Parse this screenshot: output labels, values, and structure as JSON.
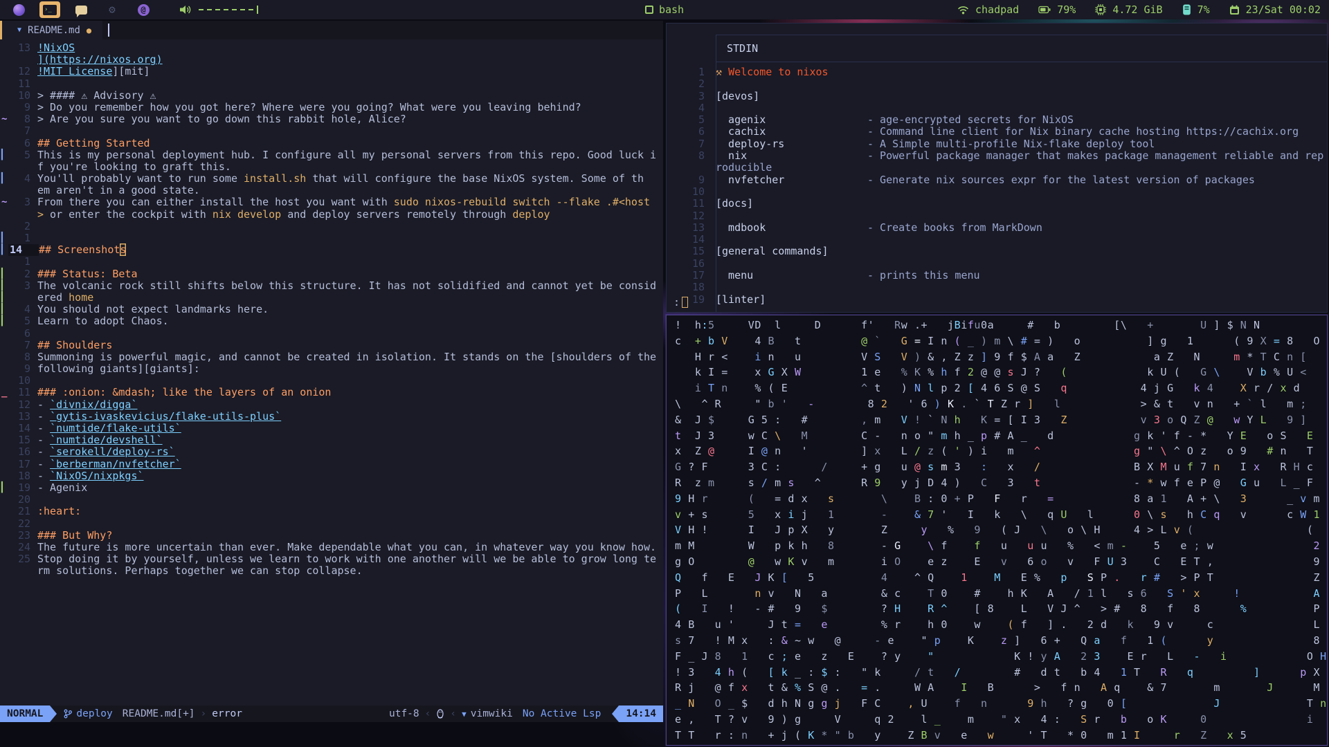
{
  "colors": {
    "fg": "#b5bdda",
    "bright": "#c8d0ea",
    "dim": "#565f89",
    "lnum": "#3b4261",
    "orange": "#ff9e64",
    "code": "#e0af68",
    "link": "#7dcfff",
    "blue": "#7aa2f7",
    "green": "#9ece6a",
    "magenta": "#bb9af7",
    "red": "#f7768e",
    "teal": "#73daca",
    "welcome": "#f4562b",
    "tool": "#d99a5e",
    "desc": "#9aa5ce"
  },
  "glyphs": {
    "gear": "⚙",
    "at": "@",
    "md_arrow": "▼",
    "modified_dot": "●",
    "term_glyph": "›_",
    "sep_r": "›",
    "sep_l": "‹",
    "vimwiki_arrow": "▼",
    "tool": "⚒",
    "prompt": ":"
  },
  "topbar": {
    "title": "bash",
    "user": "chadpad",
    "battery": "79%",
    "memory": "4.72 GiB",
    "cpu": "7%",
    "date": "23/Sat 00:02"
  },
  "editor": {
    "tab": {
      "title": "README.md"
    },
    "statusline": {
      "mode": "NORMAL",
      "branch": "deploy",
      "file": "README.md[+]",
      "diagnostic": "error",
      "encoding": "utf-8",
      "plugin": "vimwiki",
      "lsp": "No Active Lsp",
      "time": "14:14"
    },
    "lines": [
      {
        "n": "13",
        "t": [
          [
            "!NixOS",
            "link",
            "u"
          ]
        ]
      },
      {
        "n": "",
        "t": [
          [
            "](https://nixos.org)",
            "link",
            "u"
          ]
        ]
      },
      {
        "n": "12",
        "t": [
          [
            "!MIT License",
            "link",
            "u"
          ],
          [
            "][mit]",
            "fg"
          ]
        ]
      },
      {
        "n": "11"
      },
      {
        "n": "10",
        "t": [
          [
            "> #### ⚠ Advisory ⚠",
            "fg"
          ]
        ]
      },
      {
        "n": "9",
        "t": [
          [
            "> Do you remember how you got here? Where were you going? What were you leaving behind?",
            "fg"
          ]
        ]
      },
      {
        "n": "8",
        "s": "~",
        "t": [
          [
            "> Are you sure you want to go down this rabbit hole, Alice?",
            "fg"
          ]
        ]
      },
      {
        "n": "7"
      },
      {
        "n": "6",
        "t": [
          [
            "## Getting Started",
            "orange"
          ]
        ]
      },
      {
        "n": "5",
        "s": "b",
        "t": [
          [
            "This is my personal deployment hub. I configure all my personal servers from this repo. Good luck i",
            "fg"
          ]
        ]
      },
      {
        "n": "",
        "t": [
          [
            "f you're looking to graft this.",
            "fg"
          ]
        ]
      },
      {
        "n": "4",
        "s": "b",
        "t": [
          [
            "You'll probably want to run some ",
            "fg"
          ],
          [
            "install.sh",
            "code"
          ],
          [
            " that will configure the base NixOS system. Some of th",
            "fg"
          ]
        ]
      },
      {
        "n": "",
        "t": [
          [
            "em aren't in a good state.",
            "fg"
          ]
        ]
      },
      {
        "n": "3",
        "s": "~",
        "t": [
          [
            "From there you can either install the host you want with ",
            "fg"
          ],
          [
            "sudo nixos-rebuild switch --flake .#<host",
            "code"
          ]
        ]
      },
      {
        "n": "",
        "t": [
          [
            ">",
            "code"
          ],
          [
            " or enter the cockpit with ",
            "fg"
          ],
          [
            "nix develop",
            "code"
          ],
          [
            " and deploy servers remotely through ",
            "fg"
          ],
          [
            "deploy",
            "code"
          ]
        ]
      },
      {
        "n": "2"
      },
      {
        "n": "1",
        "s": "b"
      },
      {
        "n": "14",
        "cur": 1,
        "s": "b",
        "t": [
          [
            "## Screenshot",
            "orange"
          ],
          [
            "s",
            "orange",
            "k"
          ]
        ]
      },
      {
        "n": "1"
      },
      {
        "n": "2",
        "s": "g",
        "t": [
          [
            "### Status: Beta",
            "orange"
          ]
        ]
      },
      {
        "n": "3",
        "s": "g",
        "t": [
          [
            "The volcanic rock still shifts below this structure. It has not solidified and cannot yet be consid",
            "fg"
          ]
        ]
      },
      {
        "n": "",
        "s": "g",
        "t": [
          [
            "ered ",
            "fg"
          ],
          [
            "home",
            "code"
          ]
        ]
      },
      {
        "n": "4",
        "s": "g",
        "t": [
          [
            "You should not expect landmarks here.",
            "fg"
          ]
        ]
      },
      {
        "n": "5",
        "s": "g",
        "t": [
          [
            "Learn to adopt Chaos.",
            "fg"
          ]
        ]
      },
      {
        "n": "6"
      },
      {
        "n": "7",
        "t": [
          [
            "## Shoulders",
            "orange"
          ]
        ]
      },
      {
        "n": "8",
        "t": [
          [
            "Summoning is powerful magic, and cannot be created in isolation. It stands on the [shoulders of the",
            "fg"
          ]
        ]
      },
      {
        "n": "9",
        "t": [
          [
            "following giants][giants]:",
            "fg"
          ]
        ]
      },
      {
        "n": "10"
      },
      {
        "n": "11",
        "s": "_",
        "t": [
          [
            "### :onion: &mdash; like the layers of an onion",
            "orange"
          ]
        ]
      },
      {
        "n": "12",
        "t": [
          [
            "- ",
            "fg"
          ],
          [
            "`divnix/digga`",
            "link",
            "u"
          ]
        ]
      },
      {
        "n": "13",
        "t": [
          [
            "- ",
            "fg"
          ],
          [
            "`gytis-ivaskevicius/flake-utils-plus`",
            "link",
            "u"
          ]
        ]
      },
      {
        "n": "14",
        "t": [
          [
            "- ",
            "fg"
          ],
          [
            "`numtide/flake-utils`",
            "link",
            "u"
          ]
        ]
      },
      {
        "n": "15",
        "t": [
          [
            "- ",
            "fg"
          ],
          [
            "`numtide/devshell`",
            "link",
            "u"
          ]
        ]
      },
      {
        "n": "16",
        "t": [
          [
            "- ",
            "fg"
          ],
          [
            "`serokell/deploy-rs`",
            "link",
            "u"
          ]
        ]
      },
      {
        "n": "17",
        "t": [
          [
            "- ",
            "fg"
          ],
          [
            "`berberman/nvfetcher`",
            "link",
            "u"
          ]
        ]
      },
      {
        "n": "18",
        "t": [
          [
            "- ",
            "fg"
          ],
          [
            "`NixOS/nixpkgs`",
            "link",
            "u"
          ]
        ]
      },
      {
        "n": "19",
        "s": "g",
        "t": [
          [
            "- Agenix",
            "fg"
          ]
        ]
      },
      {
        "n": "20"
      },
      {
        "n": "21",
        "t": [
          [
            ":heart:",
            "orange"
          ]
        ]
      },
      {
        "n": "22"
      },
      {
        "n": "23",
        "t": [
          [
            "### But Why?",
            "orange"
          ]
        ]
      },
      {
        "n": "24",
        "t": [
          [
            "The future is more uncertain than ever. Make dependable what you can, in whatever way you know how.",
            "fg"
          ]
        ]
      },
      {
        "n": "25",
        "t": [
          [
            "Stop doing it by yourself, unless we learn to work with one another will we be able to grow long te",
            "fg"
          ]
        ]
      },
      {
        "n": "",
        "t": [
          [
            "rm solutions. Perhaps together we can stop collapse.",
            "fg"
          ]
        ]
      }
    ]
  },
  "stdin_win": {
    "title": "STDIN",
    "prompt": ":",
    "rows": [
      {
        "n": "1",
        "c": [
          [
            "⚒ ",
            "tool"
          ],
          [
            "Welcome to nixos",
            "welcome"
          ]
        ]
      },
      {
        "n": "2"
      },
      {
        "n": "3",
        "c": [
          [
            "[devos]",
            "bright"
          ]
        ]
      },
      {
        "n": "4"
      },
      {
        "n": "5",
        "c": [
          [
            "  agenix",
            "bright",
            219
          ],
          [
            "- age-encrypted secrets for NixOS",
            "desc"
          ]
        ]
      },
      {
        "n": "6",
        "c": [
          [
            "  cachix",
            "bright",
            219
          ],
          [
            "- Command line client for Nix binary cache hosting https://cachix.org",
            "desc"
          ]
        ]
      },
      {
        "n": "7",
        "c": [
          [
            "  deploy-rs",
            "bright",
            219
          ],
          [
            "- A Simple multi-profile Nix-flake deploy tool",
            "desc"
          ]
        ]
      },
      {
        "n": "8",
        "c": [
          [
            "  nix",
            "bright",
            219
          ],
          [
            "- Powerful package manager that makes package management reliable and rep",
            "desc"
          ]
        ]
      },
      {
        "n": "",
        "c": [
          [
            "roducible",
            "desc"
          ]
        ]
      },
      {
        "n": "9",
        "c": [
          [
            "  nvfetcher",
            "bright",
            219
          ],
          [
            "- Generate nix sources expr for the latest version of packages",
            "desc"
          ]
        ]
      },
      {
        "n": "10"
      },
      {
        "n": "11",
        "c": [
          [
            "[docs]",
            "bright"
          ]
        ]
      },
      {
        "n": "12"
      },
      {
        "n": "13",
        "c": [
          [
            "  mdbook",
            "bright",
            219
          ],
          [
            "- Create books from MarkDown",
            "desc"
          ]
        ]
      },
      {
        "n": "14"
      },
      {
        "n": "15",
        "c": [
          [
            "[general commands]",
            "bright"
          ]
        ]
      },
      {
        "n": "16"
      },
      {
        "n": "17",
        "c": [
          [
            "  menu",
            "bright",
            219
          ],
          [
            "- prints this menu",
            "desc"
          ]
        ]
      },
      {
        "n": "18"
      },
      {
        "n": "19",
        "c": [
          [
            "[linter]",
            "bright"
          ]
        ]
      }
    ]
  },
  "matrix": {
    "rows": [
      "!  h:5     VD  l     D      f'   Rw .+   jBifu0a     #   b        [\\   +       U ] $ N N",
      "c  + b V    4 B   t         @ `   G = I n ( _ ) m \\ # = )   o          ] g   1      ( 9 X = 8   O",
      "   H r <    i n   u         V S   V ) & , Z z ] 9 f $ A a   Z           a Z   N     m * T C n [   C",
      "   k I =    x G X W         1 e   % K % h f 2 @ @ s J ?   (            k U (   G \\    V b % U <    U",
      "   i T n    % ( E           ^ t   ) N l p 2 [ 4 6 S @ S   q           4 j G   k 4    X r / x d    d",
      "\\   ^ R     \" b '   -        8 2   ' 6 ) K . ` T Z r ]   l            > & t   v n   + ` l   m ;   N",
      "&  J $     G 5 :   #        , m   V ! ` N h   K = [ I 3   Z           v 3 o Q Z @   w Y L   9 ]   2",
      "t  J 3     w C \\   M        C -   n o \" m h _ p # A _   d            g k ' f - *   Y E   o S   E",
      "x  Z @     I @ n   '        ] x   L / z ( ' ) i   m   ^              g \" \\ ^ O z   o 9   # n   T",
      "G ? F      3 C :      /     + g   u @ s m 3   :   x   /              B X M u f 7 n   I x   R H c",
      "R  z m     s / m s   ^      R 9   y j D 4 )   C   3   t              - * w f e P @   G u   L _ F",
      "9 H r      (   = d x   s       \\    B : 0 + P   F   r   =            8 a 1   A + \\   3      _ v m",
      "v + s      5   x i j   1       -    & 7 '   I   k   \\   q U   l      0 \\ s   h C q   v      c W 1",
      "V H !      I   J p X   y       Z     y   %   9   ( J   \\   o \\ H     4 > L v (                 (",
      "m M        W   p k h   8       - G    \\ f    f   u   u u   %   < m -    5   e ; w               2",
      "g O        @   w K v   m       i O    e z    E   v   6 o   v   F U 3    C   E T ,               9",
      "Q   f   E   J K [   5          4    ^ Q    1    M   E %   p   S P .   r #   > P T               Z",
      "P   L       n v   N   a        & c    T 0    #    h K   A   / 1 l   s 6   S ' x     !           A",
      "(   I   !   - #   9   $        ? H    R ^    [ 8    L   V J ^   > #   8   f   8      %          P",
      "4 B   u '     J t =   e        % r    h 0    w    ( f   ] .   2 d   k   9 v     c               L",
      "s 7   ! M x   : & ~ w   @     - e    \" p    K    z ]   6 +   Q a   f   1 (      y               8",
      "F _ J 8   1   c ; e   z   E    ? y    \"            K ! y A   2 3    E r   L   -   i            O H",
      "! 3   4 h (   [ k _ : $ :   \" k     / t   /        #   d t   b 4   1 T   R   q         ]      p X",
      "R j   @ f x   t & % S @ .   = .     W A    I   B      >   f n   A q    & 7       m       J      M (",
      "_ N   O _ $   d h N g g j   F C    , U    f   n      9 h   ? g   0 [             J             T n",
      "e ,   T ? v   9 ) g     V     q 2    l _    m    \" x   4 :   S r   b   o K     0               i",
      "T T   r : n   + j ( K * \" b   y    Z B v   e   w     ' T   * 0   m 1 I     r   Z   x 5"
    ]
  }
}
